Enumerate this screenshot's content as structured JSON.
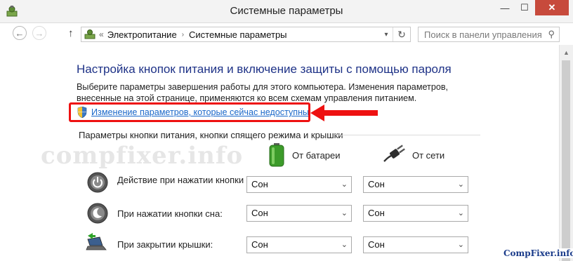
{
  "window": {
    "title": "Системные параметры",
    "minimize": "—",
    "maximize": "☐",
    "close": "✕"
  },
  "nav": {
    "back": "←",
    "forward": "→",
    "up": "↑",
    "breadcrumb_prefix": "«",
    "breadcrumb": [
      "Электропитание",
      "Системные параметры"
    ],
    "breadcrumb_sep": "›",
    "dropdown": "▾",
    "refresh": "↻",
    "search_placeholder": "Поиск в панели управления",
    "search_icon": "⚲"
  },
  "main": {
    "heading": "Настройка кнопок питания и включение защиты с помощью пароля",
    "description": "Выберите параметры завершения работы для этого компьютера. Изменения параметров, внесенные на этой странице, применяются ко всем схемам управления питанием.",
    "change_link": "Изменение параметров, которые сейчас недоступны",
    "section_title": "Параметры кнопки питания, кнопки спящего режима и крышки",
    "col_battery": "От батареи",
    "col_plugged": "От сети",
    "rows": [
      {
        "label": "Действие при нажатии кнопки питания:",
        "battery": "Сон",
        "plugged": "Сон",
        "icon": "power-button-icon"
      },
      {
        "label": "При нажатии кнопки сна:",
        "battery": "Сон",
        "plugged": "Сон",
        "icon": "sleep-button-icon"
      },
      {
        "label": "При закрытии крышки:",
        "battery": "Сон",
        "plugged": "Сон",
        "icon": "laptop-lid-icon"
      }
    ],
    "combo_arrow": "⌄"
  },
  "watermarks": {
    "center": "compfixer.info",
    "corner": "CompFixer.info"
  },
  "colors": {
    "heading": "#1e3287",
    "link": "#1a67c9",
    "highlight": "#e11111",
    "close_button": "#c74a3c"
  }
}
